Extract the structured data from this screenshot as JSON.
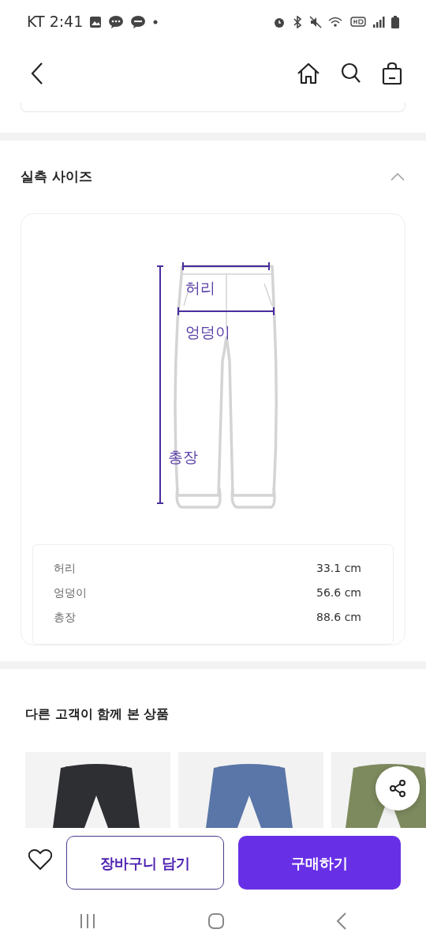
{
  "status_bar": {
    "carrier_time": "KT 2:41"
  },
  "size_section": {
    "title": "실측 사이즈",
    "expanded": true,
    "diagram_labels": [
      "허리",
      "엉덩이",
      "총장"
    ],
    "measurements": [
      {
        "label": "허리",
        "value": "33.1 cm"
      },
      {
        "label": "엉덩이",
        "value": "56.6 cm"
      },
      {
        "label": "총장",
        "value": "88.6 cm"
      }
    ]
  },
  "recommended": {
    "title": "다른 고객이 함께 본 상품"
  },
  "bottom_bar": {
    "liked": false,
    "cart_button": "장바구니 담기",
    "buy_button": "구매하기"
  }
}
